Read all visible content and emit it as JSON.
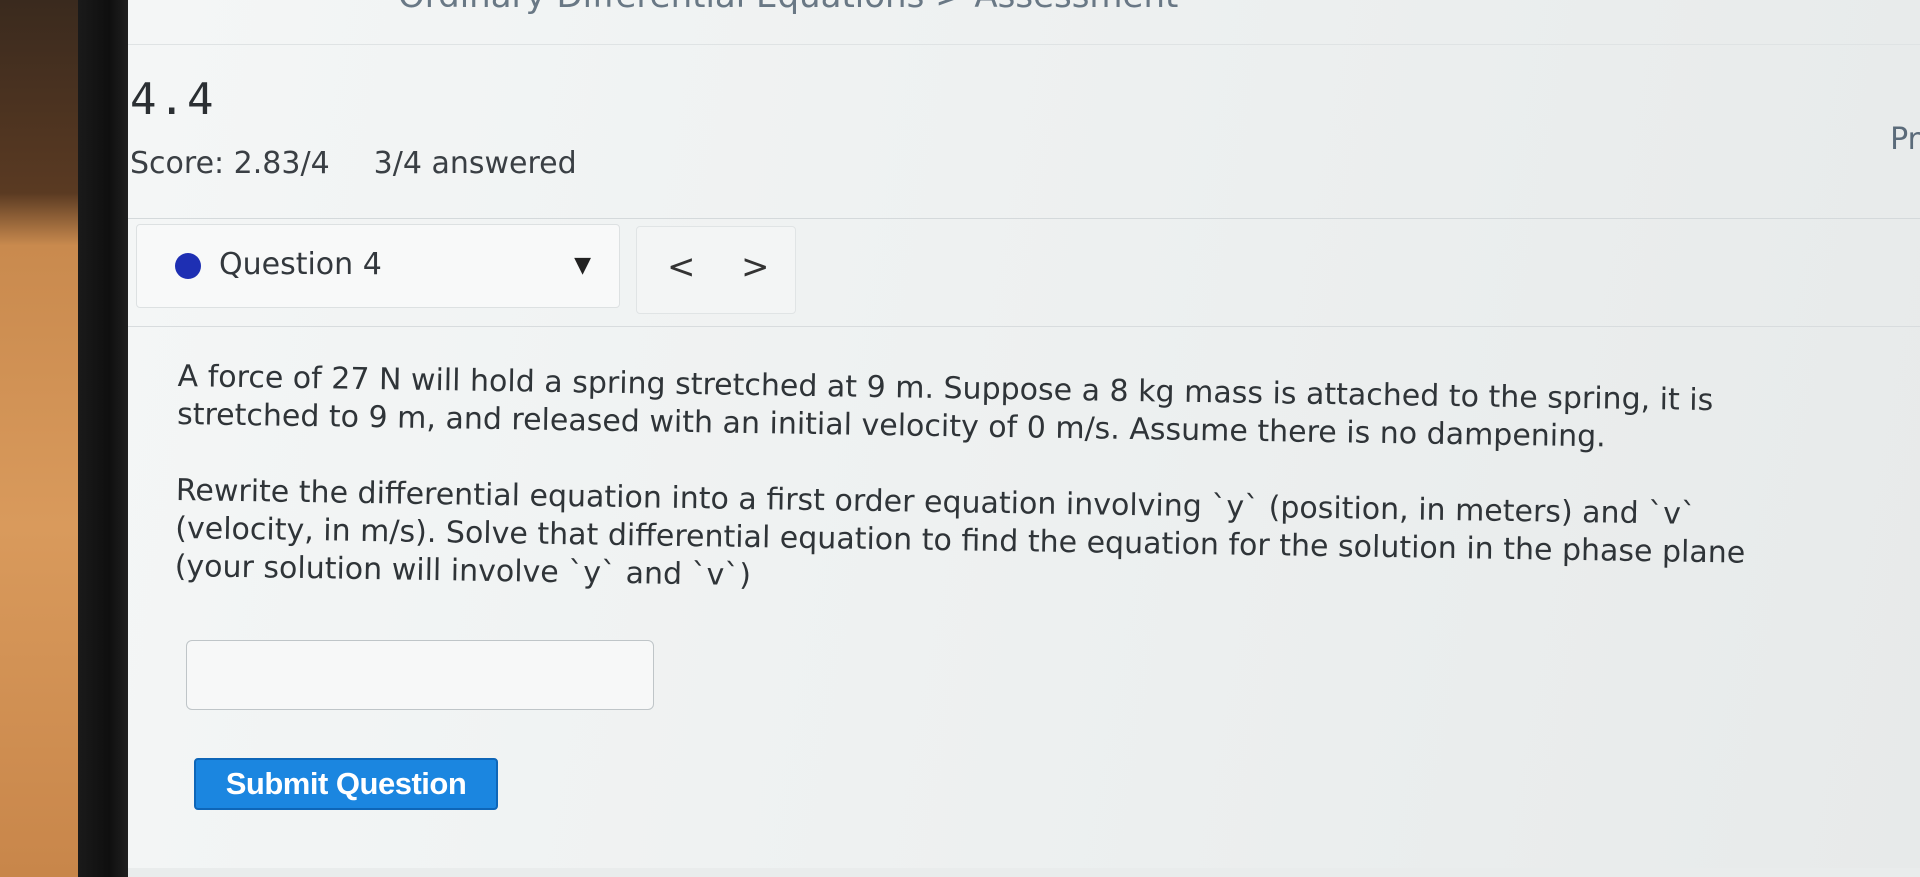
{
  "header": {
    "breadcrumb": "Ordinary Differential Equations > Assessment",
    "section_title": "4.4",
    "score": "Score: 2.83/4",
    "answered": "3/4 answered",
    "right_tab_partial": "Pr"
  },
  "question_nav": {
    "selected_question": "Question 4",
    "status_color": "#1e2fb3",
    "prev_label": "<",
    "next_label": ">"
  },
  "question": {
    "paragraph_1": "A force of 27 N will hold a spring stretched at 9 m. Suppose a 8 kg mass is attached to the spring, it is stretched to 9 m, and released with an initial velocity of 0 m/s. Assume there is no dampening.",
    "paragraph_2": "Rewrite the differential equation into a first order equation involving `y` (position, in meters) and `v` (velocity, in m/s). Solve that differential equation to find the equation for the solution in the phase plane (your solution will involve `y` and `v`)"
  },
  "answer": {
    "value": "",
    "placeholder": ""
  },
  "actions": {
    "submit_label": "Submit Question",
    "accent_color": "#1b86e0"
  }
}
